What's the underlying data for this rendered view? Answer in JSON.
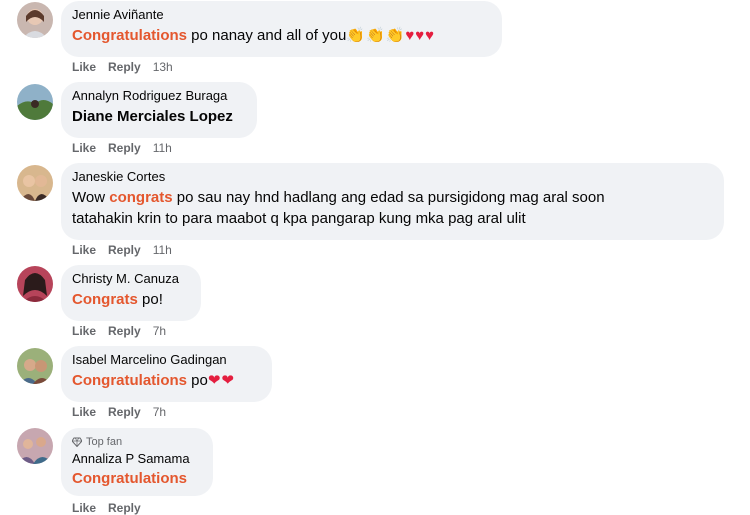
{
  "comments": [
    {
      "author": "Jennie Aviñante",
      "highlight": "Congratulations",
      "text_after": " po nanay and all of you",
      "emoji": "👏👏👏♥♥♥",
      "time": "13h"
    },
    {
      "author": "Annalyn Rodriguez Buraga",
      "mention": "Diane Merciales Lopez",
      "time": "11h"
    },
    {
      "author": "Janeskie Cortes",
      "text_before": "Wow ",
      "highlight": "congrats",
      "text_after": " po sau nay hnd hadlang ang edad sa pursigidong mag aral soon",
      "text_line2": "tatahakin krin to para maabot q kpa pangarap kung mka pag aral ulit",
      "time": "11h"
    },
    {
      "author": "Christy M. Canuza",
      "highlight": "Congrats",
      "text_after": " po!",
      "time": "7h"
    },
    {
      "author": "Isabel Marcelino Gadingan",
      "highlight": "Congratulations",
      "text_after": " po",
      "emoji": "❤❤",
      "time": "7h"
    },
    {
      "badge": "Top fan",
      "author": "Annaliza P Samama",
      "highlight": "Congratulations",
      "time": ""
    }
  ],
  "actions": {
    "like": "Like",
    "reply": "Reply"
  },
  "colors": {
    "highlight": "#e4572e",
    "bubble": "#f0f2f5",
    "meta": "#65676b"
  }
}
